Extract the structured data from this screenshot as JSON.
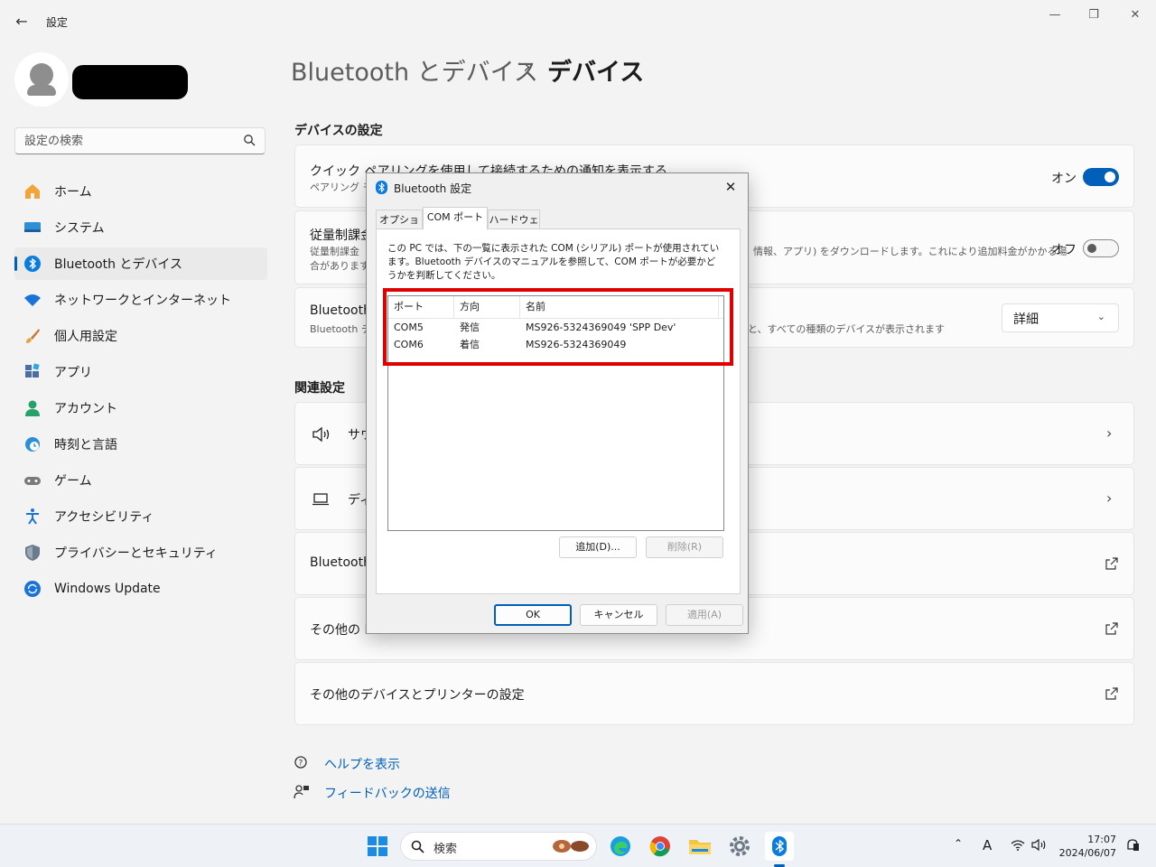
{
  "window": {
    "title": "設定",
    "back_icon": "arrow-left-icon"
  },
  "sidebar": {
    "search_placeholder": "設定の検索",
    "items": [
      {
        "label": "ホーム",
        "icon": "home-icon"
      },
      {
        "label": "システム",
        "icon": "system-icon"
      },
      {
        "label": "Bluetooth とデバイス",
        "icon": "bluetooth-icon",
        "active": true
      },
      {
        "label": "ネットワークとインターネット",
        "icon": "wifi-icon"
      },
      {
        "label": "個人用設定",
        "icon": "brush-icon"
      },
      {
        "label": "アプリ",
        "icon": "apps-icon"
      },
      {
        "label": "アカウント",
        "icon": "account-icon"
      },
      {
        "label": "時刻と言語",
        "icon": "clock-globe-icon"
      },
      {
        "label": "ゲーム",
        "icon": "gamepad-icon"
      },
      {
        "label": "アクセシビリティ",
        "icon": "accessibility-icon"
      },
      {
        "label": "プライバシーとセキュリティ",
        "icon": "shield-icon"
      },
      {
        "label": "Windows Update",
        "icon": "update-icon"
      }
    ]
  },
  "main": {
    "breadcrumb_parent": "Bluetooth とデバイス",
    "breadcrumb_sep": "›",
    "breadcrumb_current": "デバイス",
    "device_settings_title": "デバイスの設定",
    "card1": {
      "title": "クイック ペアリングを使用して接続するための通知を表示する",
      "sub": "ペアリング モー",
      "toggle_label": "オン"
    },
    "card2": {
      "title": "従量制課金",
      "sub1": "従量制課金",
      "sub2": "合があります",
      "sub_right": "情報、アプリ) をダウンロードします。これにより追加料金がかかる場",
      "toggle_label": "オフ"
    },
    "card3": {
      "title": "Bluetooth",
      "sub": "Bluetooth デ",
      "sub_right": "と、すべての種類のデバイスが表示されます",
      "dropdown_value": "詳細"
    },
    "related_title": "関連設定",
    "related": [
      {
        "label": "サウ",
        "icon": "speaker-icon"
      },
      {
        "label": "ディ",
        "icon": "laptop-icon"
      },
      {
        "label": "Bluetooth"
      },
      {
        "label": "その他の Bl"
      },
      {
        "label": "その他のデバイスとプリンターの設定"
      }
    ],
    "help_link": "ヘルプを表示",
    "feedback_link": "フィードバックの送信"
  },
  "dialog": {
    "title": "Bluetooth 設定",
    "tabs": [
      "オプション",
      "COM ポート",
      "ハードウェア"
    ],
    "active_tab": "COM ポート",
    "description": "この PC では、下の一覧に表示された COM (シリアル) ポートが使用されています。Bluetooth デバイスのマニュアルを参照して、COM ポートが必要かどうかを判断してください。",
    "columns": [
      "ポート",
      "方向",
      "名前"
    ],
    "rows": [
      {
        "port": "COM5",
        "direction": "発信",
        "name": "MS926-5324369049 'SPP Dev'"
      },
      {
        "port": "COM6",
        "direction": "着信",
        "name": "MS926-5324369049"
      }
    ],
    "add_button": "追加(D)...",
    "remove_button": "削除(R)",
    "ok_button": "OK",
    "cancel_button": "キャンセル",
    "apply_button": "適用(A)"
  },
  "taskbar": {
    "search_label": "検索",
    "time": "17:07",
    "date": "2024/06/07",
    "ime": "A"
  },
  "colors": {
    "accent": "#005fb8",
    "highlight_border": "#e00000",
    "background": "#f3f3f3"
  }
}
